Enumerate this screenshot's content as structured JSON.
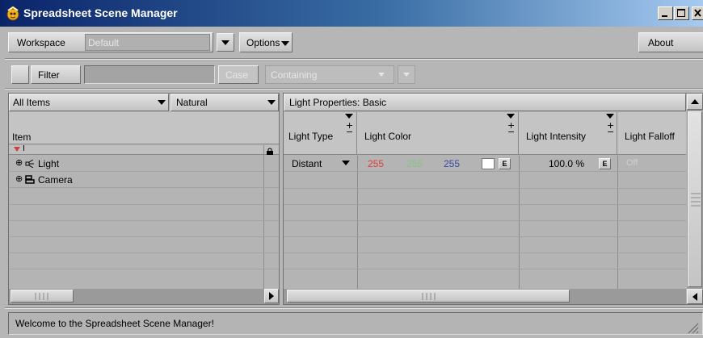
{
  "window": {
    "title": "Spreadsheet Scene Manager"
  },
  "toolbar": {
    "workspace_label": "Workspace",
    "workspace_value": "Default",
    "options_label": "Options",
    "about_label": "About"
  },
  "filterbar": {
    "filter_label": "Filter",
    "filter_value": "",
    "case_label": "Case",
    "mode_value": "Containing"
  },
  "left_panel": {
    "scope_value": "All Items",
    "sort_value": "Natural",
    "column_header": "Item",
    "items": [
      {
        "label": "Light",
        "icon": "light-icon"
      },
      {
        "label": "Camera",
        "icon": "camera-icon"
      }
    ]
  },
  "right_panel": {
    "section_title": "Light Properties: Basic",
    "columns": [
      "Light Type",
      "Light Color",
      "Light Intensity",
      "Light Falloff"
    ],
    "row": {
      "light_type": "Distant",
      "color_r": "255",
      "color_g": "255",
      "color_b": "255",
      "envelope_label": "E",
      "intensity": "100.0 %",
      "falloff": "Off"
    }
  },
  "status": {
    "message": "Welcome to the Spreadsheet Scene Manager!"
  },
  "colors": {
    "red": "#e23c3c",
    "green": "#86c486",
    "blue": "#3a4aa8",
    "title_start": "#0a246a",
    "title_end": "#a6caf0"
  }
}
